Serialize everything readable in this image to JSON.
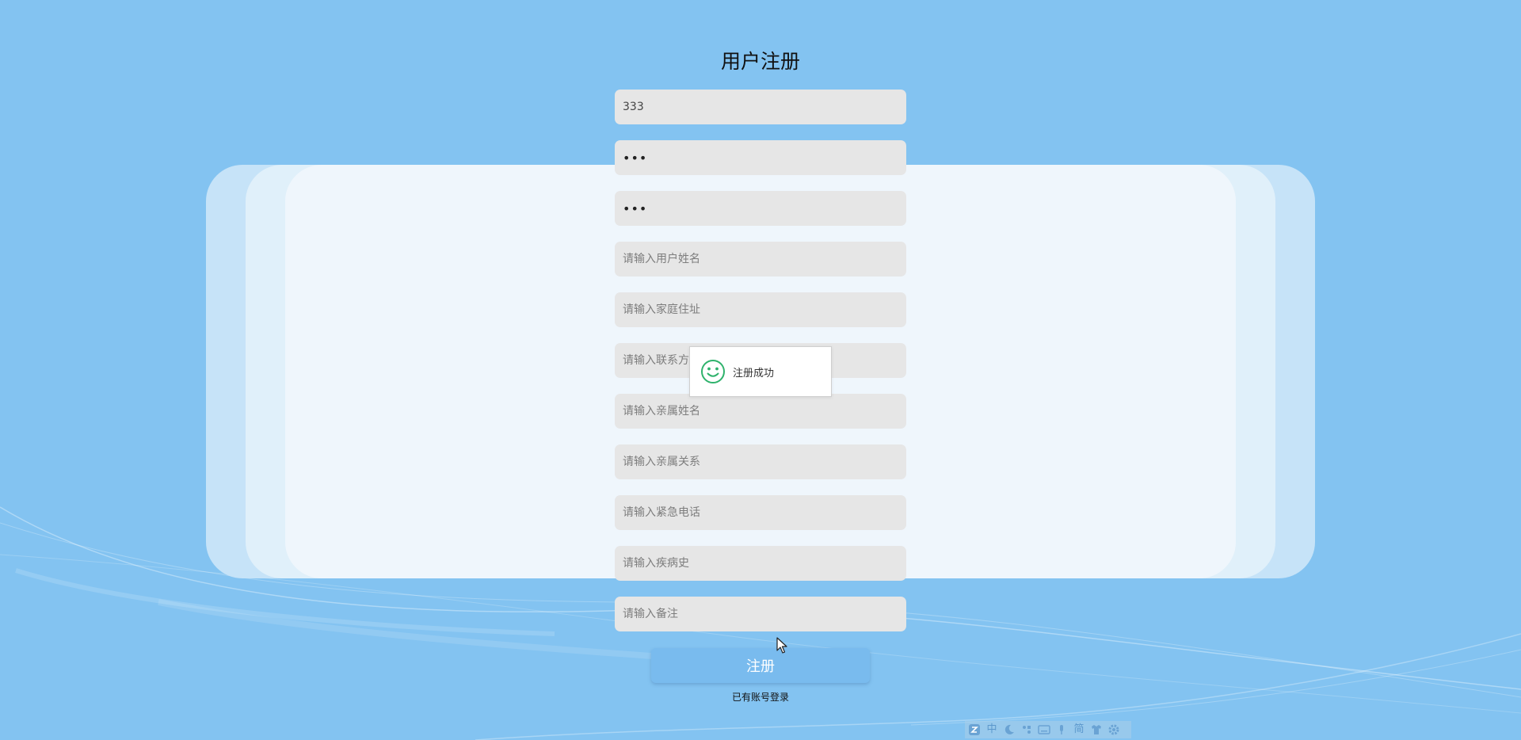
{
  "page": {
    "title": "用户注册"
  },
  "form": {
    "username": {
      "value": "333",
      "placeholder": ""
    },
    "password": {
      "value": "333",
      "placeholder": ""
    },
    "confirm_password": {
      "value": "333",
      "placeholder": ""
    },
    "name": {
      "value": "",
      "placeholder": "请输入用户姓名"
    },
    "address": {
      "value": "",
      "placeholder": "请输入家庭住址"
    },
    "phone": {
      "value": "",
      "placeholder": "请输入联系方式"
    },
    "relative_name": {
      "value": "",
      "placeholder": "请输入亲属姓名"
    },
    "relative_relation": {
      "value": "",
      "placeholder": "请输入亲属关系"
    },
    "emergency_phone": {
      "value": "",
      "placeholder": "请输入紧急电话"
    },
    "medical_history": {
      "value": "",
      "placeholder": "请输入疾病史"
    },
    "remark": {
      "value": "",
      "placeholder": "请输入备注"
    },
    "submit_label": "注册",
    "login_link": "已有账号登录"
  },
  "toast": {
    "message": "注册成功",
    "icon": "smiley-icon"
  },
  "ime_toolbar": {
    "icons": [
      "ime-logo-icon",
      "chinese-mode-icon",
      "moon-icon",
      "punctuation-icon",
      "keyboard-icon",
      "voice-icon",
      "simplified-icon",
      "skin-icon",
      "settings-icon"
    ],
    "chinese_label": "中",
    "simplified_label": "简"
  },
  "colors": {
    "background": "#83c3f1",
    "button": "#79bbee",
    "input": "#e6e6e6",
    "toast_icon": "#2fb26c"
  }
}
